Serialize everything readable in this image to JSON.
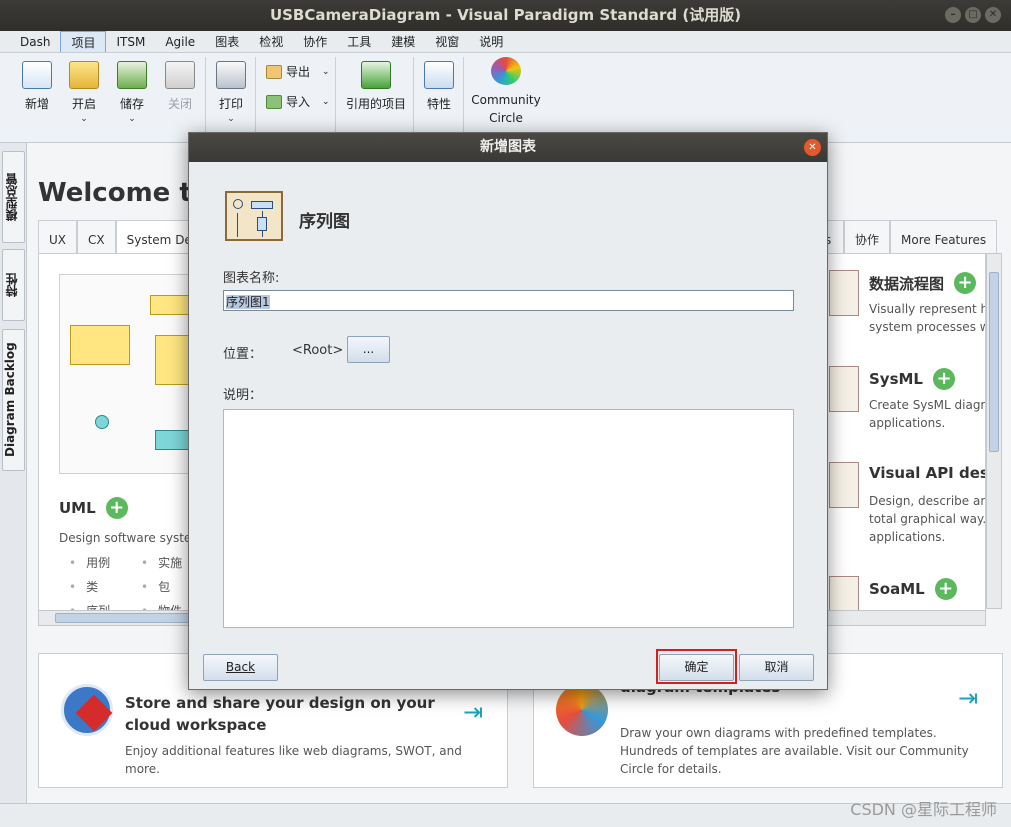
{
  "window": {
    "title": "USBCameraDiagram - Visual Paradigm Standard (试用版)"
  },
  "menu": [
    "Dash",
    "项目",
    "ITSM",
    "Agile",
    "图表",
    "检视",
    "协作",
    "工具",
    "建模",
    "视窗",
    "说明"
  ],
  "ribbon": {
    "new": "新增",
    "open": "开启",
    "save": "储存",
    "close": "关闭",
    "print": "打印",
    "export": "导出",
    "import": "导入",
    "referenced": "引用的项目",
    "properties": "特性",
    "community": "Community Circle"
  },
  "side_tabs": [
    "模型总管",
    "特性",
    "Diagram Backlog"
  ],
  "welcome": {
    "title": "Welcome to V",
    "tabs_left": [
      "UX",
      "CX",
      "System Des"
    ],
    "tabs_right": [
      "s",
      "协作",
      "More Features"
    ]
  },
  "uml": {
    "title": "UML",
    "desc": "Design software syster",
    "items": [
      "用例",
      "实施",
      "类",
      "包",
      "序列",
      "物件"
    ]
  },
  "right_cards": [
    {
      "title": "数据流程图",
      "desc": [
        "Visually represent ho",
        "system processes wi"
      ]
    },
    {
      "title": "SysML",
      "desc": [
        "Create SysML diagra",
        "applications."
      ]
    },
    {
      "title": "Visual API design",
      "desc": [
        "Design, describe and",
        "total graphical way. C",
        "applications."
      ]
    },
    {
      "title": "SoaML",
      "desc": []
    }
  ],
  "bottom_cards": [
    {
      "title": "Store and share your design on your cloud workspace",
      "desc": "Enjoy additional features like web diagrams, SWOT, and more."
    },
    {
      "title": "diagram templates",
      "desc": "Draw your own diagrams with predefined templates. Hundreds of templates are available. Visit our Community Circle for details."
    }
  ],
  "dialog": {
    "title": "新增图表",
    "diagram_type": "序列图",
    "name_label": "图表名称:",
    "name_value": "序列图1",
    "location_label": "位置：",
    "location_value": "<Root>",
    "browse": "...",
    "description_label": "说明：",
    "back": "Back",
    "ok": "确定",
    "cancel": "取消"
  },
  "watermark": "CSDN @星际工程师"
}
